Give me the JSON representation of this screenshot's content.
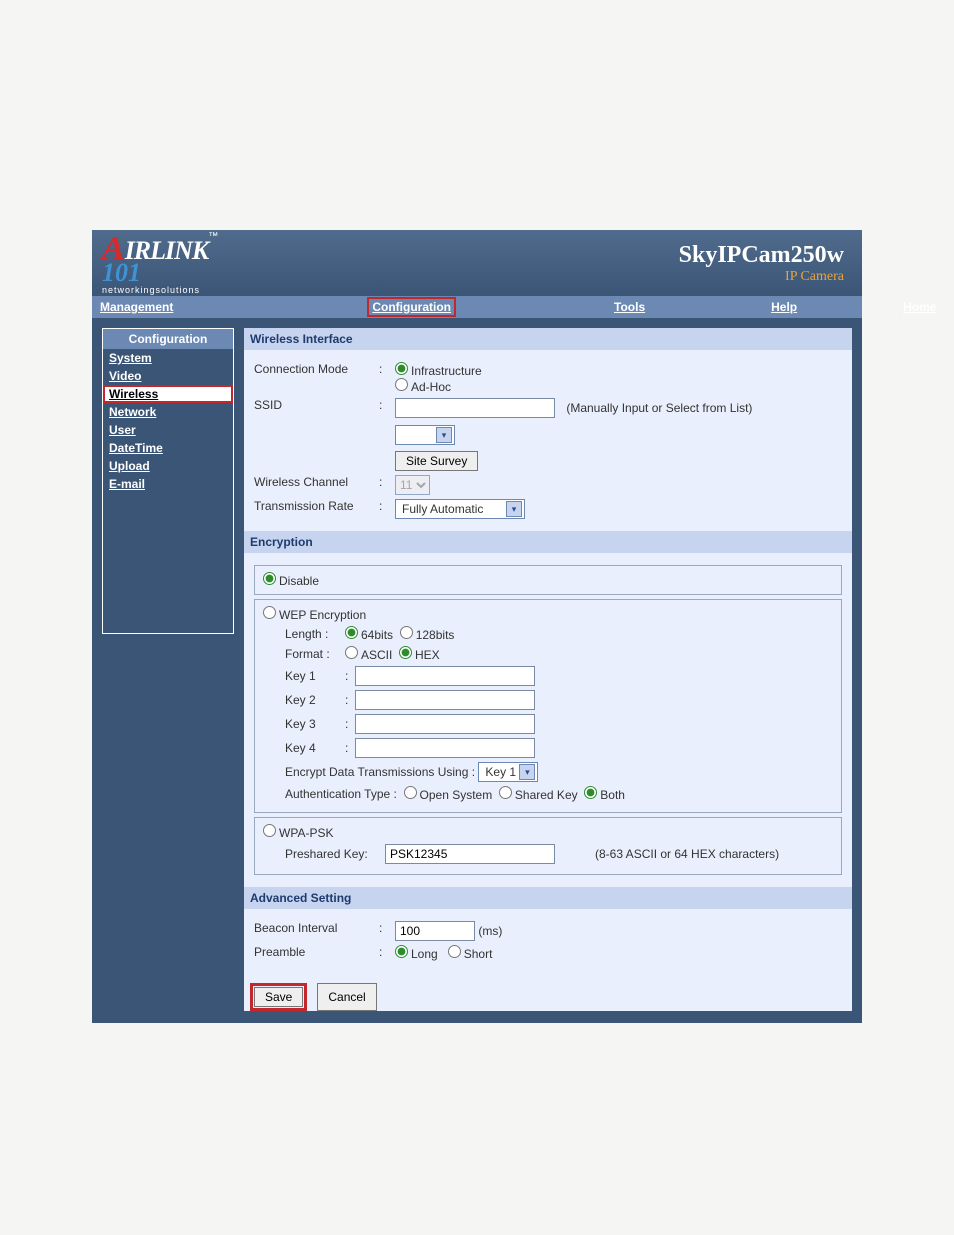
{
  "logo": {
    "brand_a": "A",
    "brand_rest": "IRLINK",
    "brand_101": "101",
    "tm": "™",
    "tagline": "networkingsolutions"
  },
  "product": {
    "name": "SkyIPCam250w",
    "sub": "IP Camera"
  },
  "topnav": {
    "management": "Management",
    "configuration": "Configuration",
    "tools": "Tools",
    "help": "Help",
    "home": "Home"
  },
  "sidebar": {
    "head": "Configuration",
    "items": {
      "system": "System",
      "video": "Video",
      "wireless": "Wireless",
      "network": "Network",
      "user": "User",
      "datetime": "DateTime",
      "upload": "Upload",
      "email": "E-mail"
    }
  },
  "wi": {
    "head": "Wireless Interface",
    "conn_mode_lbl": "Connection Mode",
    "infra": "Infrastructure",
    "adhoc": "Ad-Hoc",
    "ssid_lbl": "SSID",
    "ssid_hint": "(Manually Input or Select from List)",
    "site_survey": "Site Survey",
    "channel_lbl": "Wireless Channel",
    "channel_val": "11",
    "rate_lbl": "Transmission Rate",
    "rate_val": "Fully Automatic"
  },
  "enc": {
    "head": "Encryption",
    "disable": "Disable",
    "wep": "WEP Encryption",
    "length_lbl": "Length :",
    "b64": "64bits",
    "b128": "128bits",
    "format_lbl": "Format :",
    "ascii": "ASCII",
    "hex": "HEX",
    "key1": "Key 1",
    "key2": "Key 2",
    "key3": "Key 3",
    "key4": "Key 4",
    "enc_using": "Encrypt Data Transmissions Using  :",
    "enc_using_val": "Key 1",
    "auth_lbl": "Authentication Type  :",
    "open": "Open System",
    "shared": "Shared Key",
    "both": "Both",
    "wpa": "WPA-PSK",
    "psk_lbl": "Preshared Key:",
    "psk_val": "PSK12345",
    "psk_hint": "(8-63 ASCII or 64 HEX characters)"
  },
  "adv": {
    "head": "Advanced Setting",
    "beacon_lbl": "Beacon Interval",
    "beacon_val": "100",
    "beacon_unit": "(ms)",
    "preamble_lbl": "Preamble",
    "long": "Long",
    "short": "Short"
  },
  "buttons": {
    "save": "Save",
    "cancel": "Cancel"
  }
}
